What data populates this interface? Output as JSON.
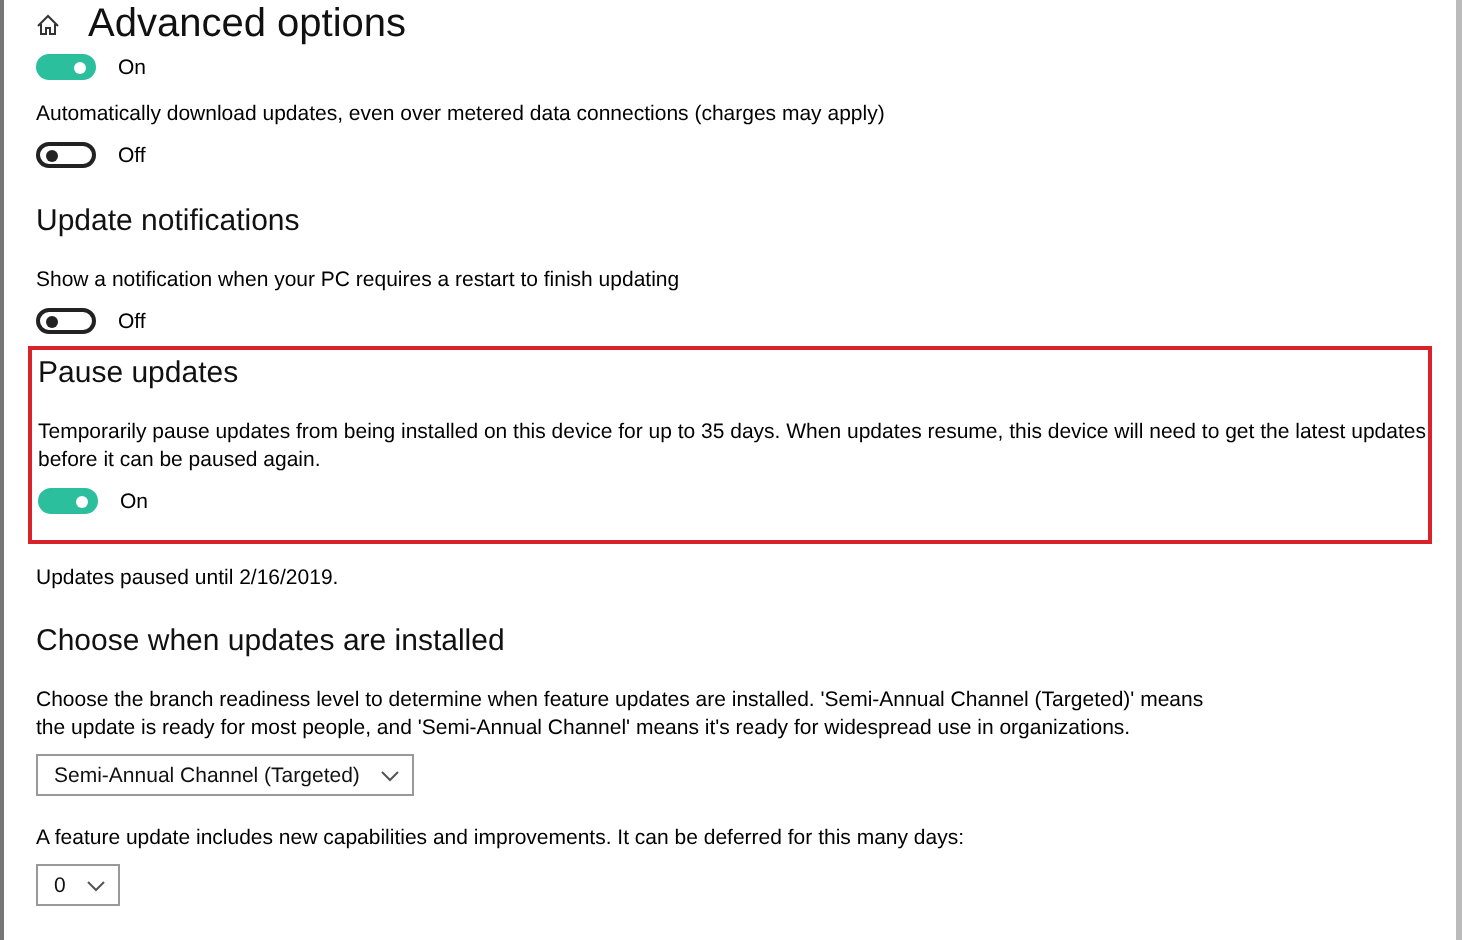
{
  "page": {
    "title": "Advanced options"
  },
  "sections": [
    {
      "highlighted": false,
      "items": [
        {
          "kind": "toggle",
          "on": true,
          "state_label": "On"
        },
        {
          "kind": "text",
          "text": "Automatically download updates, even over metered data connections (charges may apply)"
        },
        {
          "kind": "toggle",
          "on": false,
          "state_label": "Off"
        }
      ]
    },
    {
      "heading": "Update notifications",
      "highlighted": false,
      "items": [
        {
          "kind": "text",
          "text": "Show a notification when your PC requires a restart to finish updating"
        },
        {
          "kind": "toggle",
          "on": false,
          "state_label": "Off"
        }
      ]
    },
    {
      "heading": "Pause updates",
      "highlighted": true,
      "items": [
        {
          "kind": "text",
          "text": "Temporarily pause updates from being installed on this device for up to 35 days. When updates resume, this device will need to get the latest updates before it can be paused again."
        },
        {
          "kind": "toggle",
          "on": true,
          "state_label": "On"
        }
      ]
    },
    {
      "highlighted": false,
      "items": [
        {
          "kind": "text",
          "text": "Updates paused until 2/16/2019."
        }
      ]
    },
    {
      "heading": "Choose when updates are installed",
      "highlighted": false,
      "items": [
        {
          "kind": "text",
          "text": "Choose the branch readiness level to determine when feature updates are installed. 'Semi-Annual Channel (Targeted)' means the update is ready for most people, and 'Semi-Annual Channel' means it's ready for widespread use in organizations."
        },
        {
          "kind": "dropdown",
          "value": "Semi-Annual Channel (Targeted)"
        },
        {
          "kind": "text",
          "text": "A feature update includes new capabilities and improvements. It can be deferred for this many days:"
        },
        {
          "kind": "dropdown",
          "value": "0"
        }
      ]
    }
  ]
}
